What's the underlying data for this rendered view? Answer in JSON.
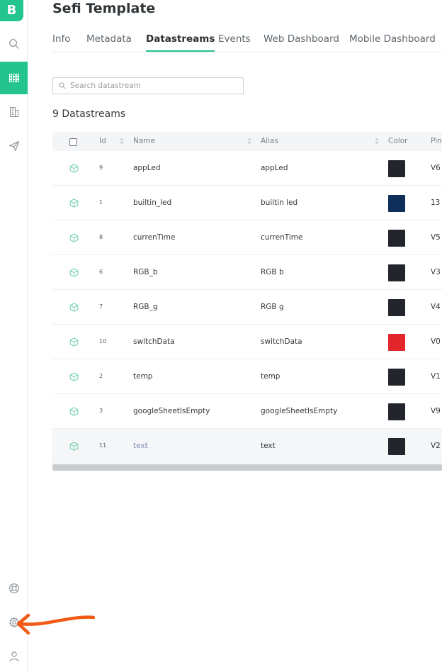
{
  "app": {
    "logo_letter": "B",
    "accent_color": "#23c48e"
  },
  "sidebar": {
    "top_items": [
      {
        "icon": "search-icon"
      },
      {
        "icon": "grid-icon",
        "active": true
      },
      {
        "icon": "building-icon"
      },
      {
        "icon": "send-icon"
      }
    ],
    "bottom_items": [
      {
        "icon": "lifebuoy-icon"
      },
      {
        "icon": "gear-icon"
      },
      {
        "icon": "user-icon"
      }
    ]
  },
  "header": {
    "title": "Sefi Template"
  },
  "tabs": [
    {
      "label": "Info"
    },
    {
      "label": "Metadata"
    },
    {
      "label": "Datastreams",
      "active": true
    },
    {
      "label": "Events"
    },
    {
      "label": "Web Dashboard"
    },
    {
      "label": "Mobile Dashboard"
    }
  ],
  "search": {
    "placeholder": "Search datastream"
  },
  "summary": {
    "count_label": "9 Datastreams"
  },
  "table": {
    "columns": {
      "id": "Id",
      "name": "Name",
      "alias": "Alias",
      "color": "Color",
      "pin": "Pin"
    },
    "rows": [
      {
        "id": "9",
        "name": "appLed",
        "alias": "appLed",
        "color": "#22252b",
        "pin": "V6"
      },
      {
        "id": "1",
        "name": "builtin_led",
        "alias": "builtin led",
        "color": "#0e2f59",
        "pin": "13"
      },
      {
        "id": "8",
        "name": "currenTime",
        "alias": "currenTime",
        "color": "#22252b",
        "pin": "V5"
      },
      {
        "id": "6",
        "name": "RGB_b",
        "alias": "RGB b",
        "color": "#22252b",
        "pin": "V3"
      },
      {
        "id": "7",
        "name": "RGB_g",
        "alias": "RGB g",
        "color": "#22252b",
        "pin": "V4"
      },
      {
        "id": "10",
        "name": "switchData",
        "alias": "switchData",
        "color": "#e3262c",
        "pin": "V0"
      },
      {
        "id": "2",
        "name": "temp",
        "alias": "temp",
        "color": "#22252b",
        "pin": "V1"
      },
      {
        "id": "3",
        "name": "googleSheetIsEmpty",
        "alias": "googleSheetIsEmpty",
        "color": "#22252b",
        "pin": "V9"
      },
      {
        "id": "11",
        "name": "text",
        "alias": "text",
        "color": "#22252b",
        "pin": "V2",
        "hover": true
      }
    ]
  },
  "annotation": {
    "arrow_color": "#f05a14"
  }
}
